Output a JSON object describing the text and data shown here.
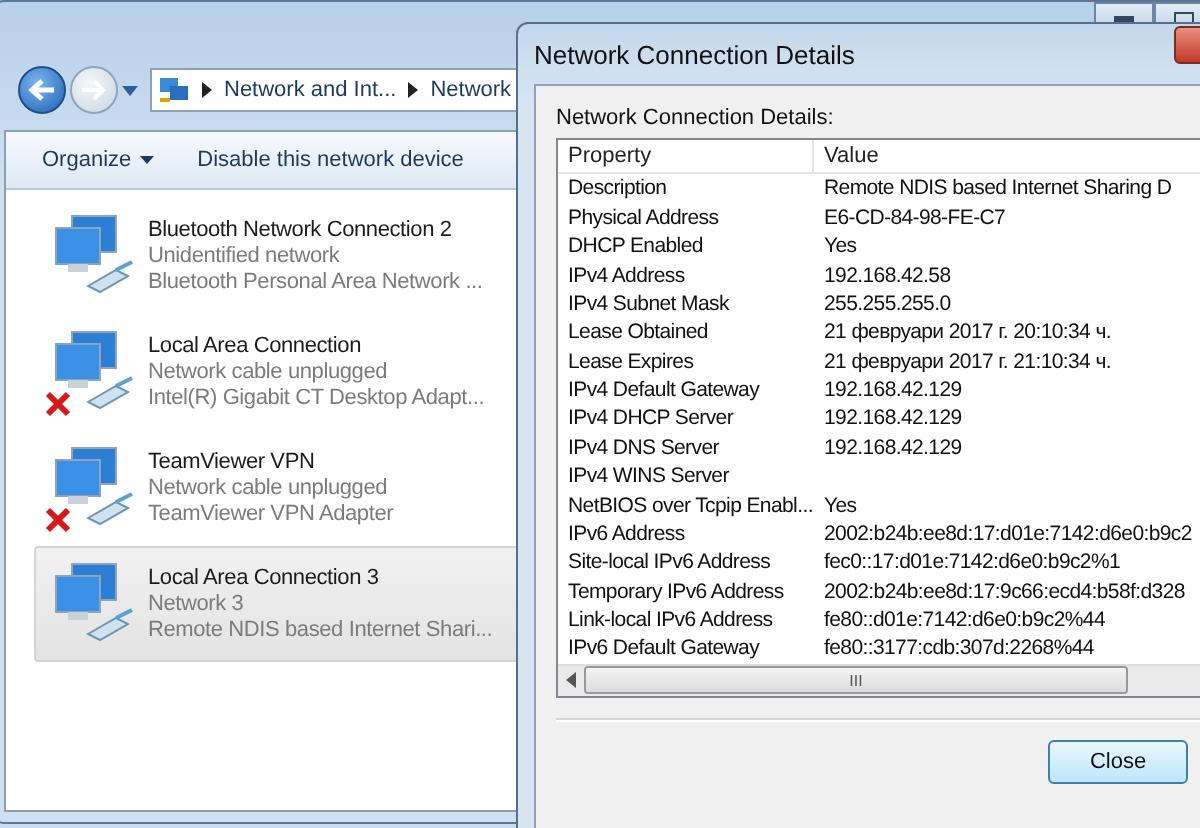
{
  "explorer": {
    "address": [
      "Network and Int...",
      "Network"
    ],
    "toolbar": {
      "organize": "Organize",
      "action": "Disable this network device"
    },
    "connections": [
      {
        "name": "Bluetooth Network Connection 2",
        "status": "Unidentified network",
        "device": "Bluetooth Personal Area Network ...",
        "disconnected": false,
        "selected": false
      },
      {
        "name": "Local Area Connection",
        "status": "Network cable unplugged",
        "device": "Intel(R) Gigabit CT Desktop Adapt...",
        "disconnected": true,
        "selected": false
      },
      {
        "name": "TeamViewer VPN",
        "status": "Network cable unplugged",
        "device": "TeamViewer VPN Adapter",
        "disconnected": true,
        "selected": false
      },
      {
        "name": "Local Area Connection 3",
        "status": "Network  3",
        "device": "Remote NDIS based Internet Shari...",
        "disconnected": false,
        "selected": true
      }
    ]
  },
  "dialog": {
    "title": "Network Connection Details",
    "label": "Network Connection Details:",
    "columns": [
      "Property",
      "Value"
    ],
    "rows": [
      [
        "Description",
        "Remote NDIS based Internet Sharing D"
      ],
      [
        "Physical Address",
        "E6-CD-84-98-FE-C7"
      ],
      [
        "DHCP Enabled",
        "Yes"
      ],
      [
        "IPv4 Address",
        "192.168.42.58"
      ],
      [
        "IPv4 Subnet Mask",
        "255.255.255.0"
      ],
      [
        "Lease Obtained",
        "21 февруари 2017 г. 20:10:34 ч."
      ],
      [
        "Lease Expires",
        "21 февруари 2017 г. 21:10:34 ч."
      ],
      [
        "IPv4 Default Gateway",
        "192.168.42.129"
      ],
      [
        "IPv4 DHCP Server",
        "192.168.42.129"
      ],
      [
        "IPv4 DNS Server",
        "192.168.42.129"
      ],
      [
        "IPv4 WINS Server",
        ""
      ],
      [
        "NetBIOS over Tcpip Enabl...",
        "Yes"
      ],
      [
        "IPv6 Address",
        "2002:b24b:ee8d:17:d01e:7142:d6e0:b9c2"
      ],
      [
        "Site-local IPv6 Address",
        "fec0::17:d01e:7142:d6e0:b9c2%1"
      ],
      [
        "Temporary IPv6 Address",
        "2002:b24b:ee8d:17:9c66:ecd4:b58f:d328"
      ],
      [
        "Link-local IPv6 Address",
        "fe80::d01e:7142:d6e0:b9c2%44"
      ],
      [
        "IPv6 Default Gateway",
        "fe80::3177:cdb:307d:2268%44"
      ]
    ],
    "scroll_grip": "III",
    "close": "Close"
  }
}
